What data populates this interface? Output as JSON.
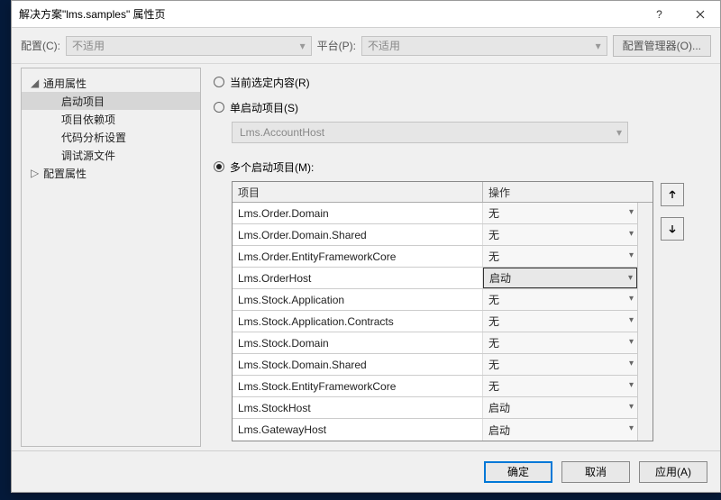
{
  "titlebar": {
    "title": "解决方案\"lms.samples\" 属性页"
  },
  "toolbar": {
    "config_label": "配置(C):",
    "config_value": "不适用",
    "platform_label": "平台(P):",
    "platform_value": "不适用",
    "config_manager": "配置管理器(O)..."
  },
  "tree": {
    "common": "通用属性",
    "startup": "启动项目",
    "deps": "项目依赖项",
    "code_analysis": "代码分析设置",
    "debug_src": "调试源文件",
    "cfg_props": "配置属性"
  },
  "radios": {
    "current": "当前选定内容(R)",
    "single": "单启动项目(S)",
    "multi": "多个启动项目(M):"
  },
  "single_value": "Lms.AccountHost",
  "grid": {
    "h_project": "项目",
    "h_action": "操作",
    "rows": [
      {
        "name": "Lms.Order.Domain",
        "action": "无"
      },
      {
        "name": "Lms.Order.Domain.Shared",
        "action": "无"
      },
      {
        "name": "Lms.Order.EntityFrameworkCore",
        "action": "无"
      },
      {
        "name": "Lms.OrderHost",
        "action": "启动"
      },
      {
        "name": "Lms.Stock.Application",
        "action": "无"
      },
      {
        "name": "Lms.Stock.Application.Contracts",
        "action": "无"
      },
      {
        "name": "Lms.Stock.Domain",
        "action": "无"
      },
      {
        "name": "Lms.Stock.Domain.Shared",
        "action": "无"
      },
      {
        "name": "Lms.Stock.EntityFrameworkCore",
        "action": "无"
      },
      {
        "name": "Lms.StockHost",
        "action": "启动"
      },
      {
        "name": "Lms.GatewayHost",
        "action": "启动"
      }
    ],
    "selected_index": 3
  },
  "footer": {
    "ok": "确定",
    "cancel": "取消",
    "apply": "应用(A)"
  }
}
